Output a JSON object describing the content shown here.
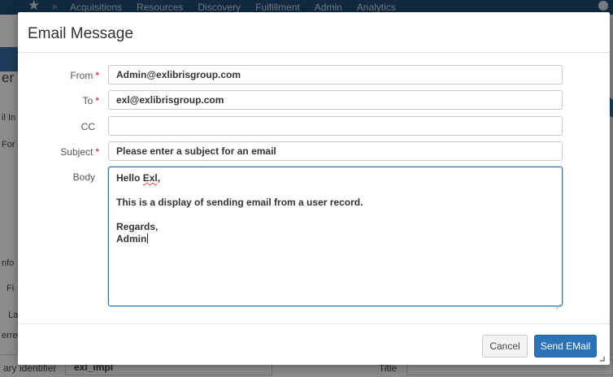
{
  "background": {
    "nav_items": [
      "Acquisitions",
      "Resources",
      "Discovery",
      "Fulfillment",
      "Admin",
      "Analytics"
    ],
    "fragments": [
      "ers",
      "er",
      "il In",
      "For",
      "nfo",
      "Fi",
      "La",
      "erre"
    ],
    "bottom_label_left": "ary identifier",
    "bottom_value": "exl_impl",
    "bottom_label_right": "Title"
  },
  "modal": {
    "title": "Email Message",
    "from_label": "From",
    "from_value": "Admin@exlibrisgroup.com",
    "to_label": "To",
    "to_value": "exl@exlibrisgroup.com",
    "cc_label": "CC",
    "cc_value": "",
    "subject_label": "Subject",
    "subject_value": "Please enter a subject for an email",
    "body_label": "Body",
    "body_greeting": "Hello",
    "body_name": "Exl",
    "body_comma": ",",
    "body_line2": "This is a display of sending email from a user record.",
    "body_line3": "Regards,",
    "body_line4": "Admin",
    "required_mark": "*",
    "cancel_label": "Cancel",
    "send_label": "Send EMail"
  },
  "colors": {
    "primary": "#2b73b6",
    "required": "#d0021b",
    "nav": "#1f4e79"
  }
}
